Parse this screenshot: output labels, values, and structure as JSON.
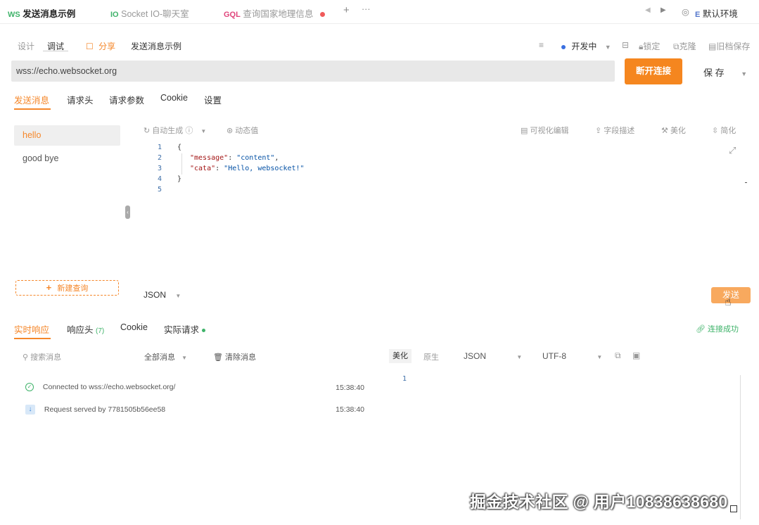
{
  "top_tabs": [
    {
      "prefix": "WS",
      "label": "发送消息示例"
    },
    {
      "prefix": "IO",
      "label": "Socket IO-聊天室"
    },
    {
      "prefix": "GQL",
      "label": "查询国家地理信息"
    }
  ],
  "top_right": {
    "env_label": "默认环境"
  },
  "header": {
    "mode_design": "设计",
    "mode_debug": "调试",
    "share": "分享",
    "title": "发送消息示例",
    "status": "开发中",
    "lock": "锁定",
    "clone": "克隆",
    "old_save": "旧档保存"
  },
  "url_bar": {
    "value": "wss://echo.websocket.org"
  },
  "actions": {
    "disconnect": "断开连接",
    "save": "保 存"
  },
  "request_tabs": [
    "发送消息",
    "请求头",
    "请求参数",
    "Cookie",
    "设置"
  ],
  "messages": [
    "hello",
    "good bye"
  ],
  "new_query": "新建查询",
  "editor_toolbar": {
    "auto_gen": "自动生成",
    "dynamic": "动态值",
    "visual_edit": "可视化编辑",
    "field_desc": "字段描述",
    "beautify": "美化",
    "simplify": "简化"
  },
  "code_lines": [
    "1",
    "2",
    "3",
    "4",
    "5"
  ],
  "code": {
    "open": "{",
    "k1": "\"message\"",
    "v1": "\"content\"",
    "k2": "\"cata\"",
    "v2": "\"Hello, websocket!\"",
    "close": "}"
  },
  "format": "JSON",
  "send": "发送",
  "response_tabs": [
    "实时响应",
    "响应头",
    "Cookie",
    "实际请求"
  ],
  "response_header_count": "(7)",
  "connected_status": "连接成功",
  "log_toolbar": {
    "search_placeholder": "搜索消息",
    "filter": "全部消息",
    "clear": "清除消息",
    "beautify": "美化",
    "raw": "原生",
    "format": "JSON",
    "encoding": "UTF-8"
  },
  "log": [
    {
      "text": "Connected to wss://echo.websocket.org/",
      "time": "15:38:40"
    },
    {
      "text": "Request served by 7781505b56ee58",
      "time": "15:38:40"
    }
  ],
  "detail_line": "1",
  "watermark": "掘金技术社区 @ 用户10838638680",
  "colors": {
    "accent": "#f5872a",
    "success": "#3fb36a",
    "bar": "#e8e8e8"
  }
}
